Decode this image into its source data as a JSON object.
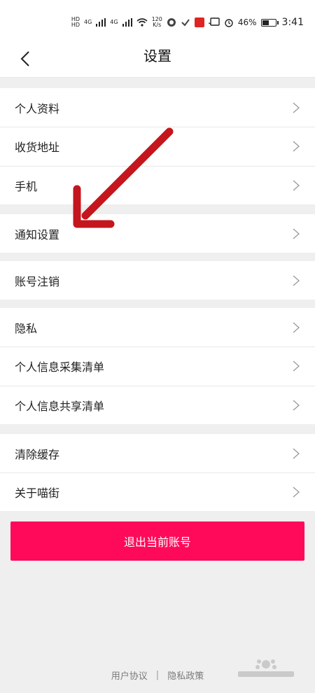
{
  "status_bar": {
    "hd1": "HD",
    "hd2": "HD",
    "net1": "4G",
    "net2": "4G",
    "speed_value": "120",
    "speed_unit": "K/s",
    "battery": "46%",
    "time": "3:41"
  },
  "header": {
    "title": "设置"
  },
  "menu": {
    "group1": [
      {
        "label": "个人资料"
      },
      {
        "label": "收货地址"
      },
      {
        "label": "手机"
      }
    ],
    "group2": [
      {
        "label": "通知设置"
      }
    ],
    "group3": [
      {
        "label": "账号注销"
      }
    ],
    "group4": [
      {
        "label": "隐私"
      },
      {
        "label": "个人信息采集清单"
      },
      {
        "label": "个人信息共享清单"
      }
    ],
    "group5": [
      {
        "label": "清除缓存"
      },
      {
        "label": "关于喵街"
      }
    ]
  },
  "logout_label": "退出当前账号",
  "footer": {
    "user_agreement": "用户协议",
    "separator": "|",
    "privacy_policy": "隐私政策"
  },
  "colors": {
    "accent": "#ff0a5a",
    "arrow": "#c4161c",
    "background": "#efefef"
  },
  "icons": {
    "back": "chevron-left-icon",
    "row": "chevron-right-icon"
  }
}
